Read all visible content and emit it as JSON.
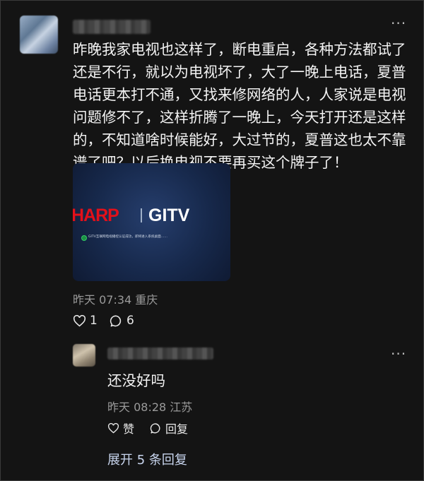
{
  "post": {
    "more": "···",
    "text": "昨晚我家电视也这样了，断电重启，各种方法都试了还是不行，就以为电视坏了，大了一晚上电话，夏普电话更本打不通，又找来修网络的人，人家说是电视问题修不了，这样折腾了一晚上，今天打开还是这样的，不知道啥时候能好，大过节的，夏普这也太不靠谱了吧？以后换电视不要再买这个牌子了！",
    "image": {
      "brand_left": "HARP",
      "brand_right": "GITV",
      "message": "GITV互联网电视播控认证成功，即将进入系统桌面……"
    },
    "meta": "昨天 07:34 重庆",
    "likes": "1",
    "comments": "6"
  },
  "reply": {
    "more": "···",
    "text": "还没好吗",
    "meta": "昨天 08:28 江苏",
    "like_label": "赞",
    "reply_label": "回复"
  },
  "expand_label": "展开 5 条回复"
}
